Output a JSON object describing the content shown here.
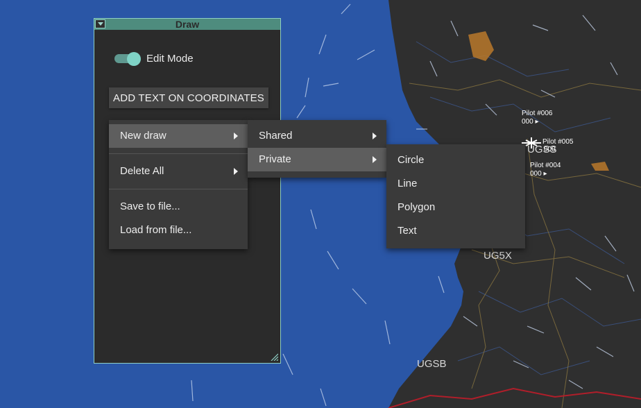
{
  "map": {
    "labels": [
      {
        "id": "ug5x",
        "text": "UG5X"
      },
      {
        "id": "ugsb",
        "text": "UGSB"
      },
      {
        "id": "ugxx",
        "text": "UGSS"
      }
    ],
    "pilots": [
      {
        "name": "Pilot #006",
        "info": "000 ▸"
      },
      {
        "name": "Pilot #005",
        "info": "000"
      },
      {
        "name": "Pilot #004",
        "info": "000 ▸"
      }
    ]
  },
  "panel": {
    "title": "Draw",
    "edit_mode_label": "Edit Mode",
    "edit_mode_on": true,
    "add_text_label": "ADD TEXT ON COORDINATES"
  },
  "menu_main": {
    "new_draw": "New draw",
    "delete_all": "Delete All",
    "save": "Save to file...",
    "load": "Load from file..."
  },
  "menu_new_draw": {
    "shared": "Shared",
    "private": "Private"
  },
  "menu_private": {
    "circle": "Circle",
    "line": "Line",
    "polygon": "Polygon",
    "text": "Text"
  },
  "colors": {
    "sea": "#2a56a6",
    "land": "#2e2e2e",
    "accent": "#7fd3c6",
    "header": "#4e8c7e",
    "menu_bg": "#3a3a3a",
    "menu_hover": "#5e5e5e",
    "border_red": "#b01e2a",
    "area_orange": "#b8782a"
  }
}
